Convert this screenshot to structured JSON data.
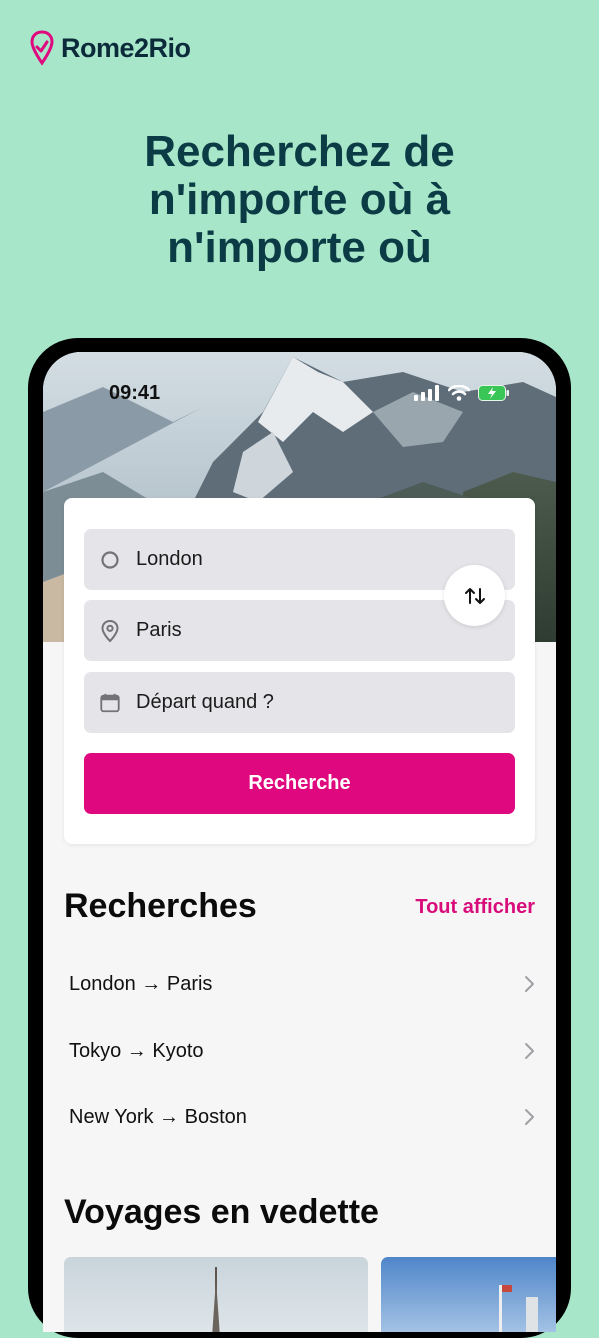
{
  "brand": {
    "name": "Rome2Rio",
    "color": "#e0087e"
  },
  "headline": [
    "Recherchez de",
    "n'importe où à",
    "n'importe où"
  ],
  "status_bar": {
    "time": "09:41"
  },
  "search": {
    "origin": "London",
    "destination": "Paris",
    "date_placeholder": "Départ quand ?",
    "button_label": "Recherche"
  },
  "recent": {
    "title": "Recherches",
    "see_all": "Tout afficher",
    "items": [
      {
        "label": "London → Paris"
      },
      {
        "label": "Tokyo → Kyoto"
      },
      {
        "label": "New York → Boston"
      }
    ]
  },
  "featured": {
    "title": "Voyages en vedette"
  },
  "icons": [
    "logo-pin-icon",
    "signal-icon",
    "wifi-icon",
    "battery-icon",
    "origin-circle-icon",
    "location-pin-icon",
    "calendar-icon",
    "swap-icon",
    "chevron-right-icon"
  ]
}
